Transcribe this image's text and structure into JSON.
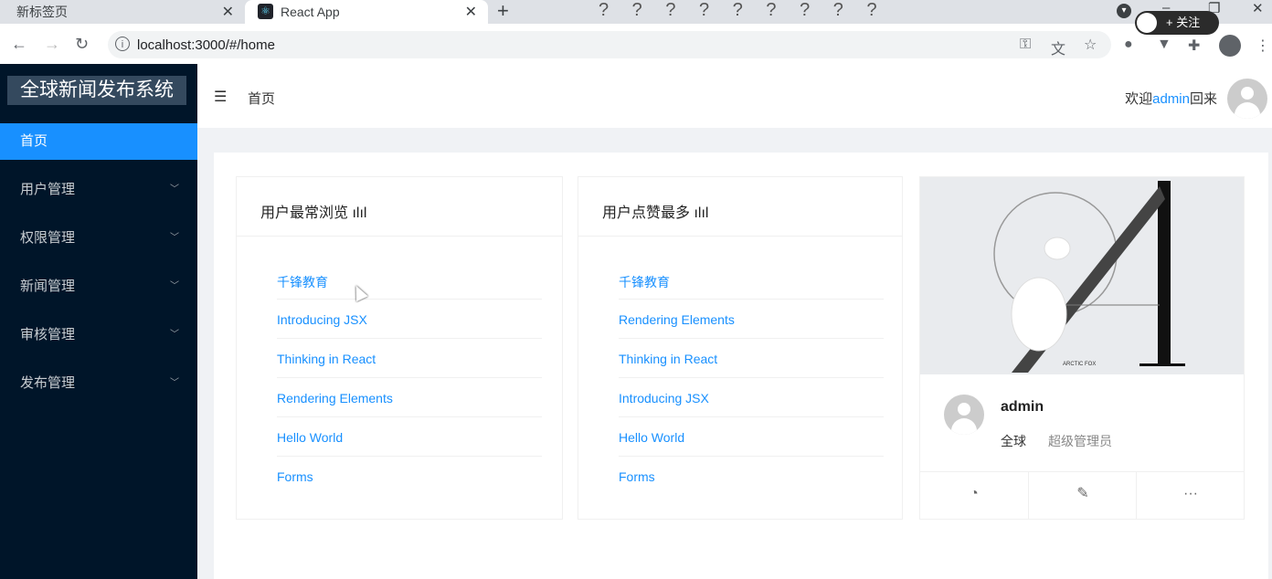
{
  "browser": {
    "tabs": [
      {
        "title": "新标签页",
        "active": false
      },
      {
        "title": "React App",
        "active": true
      }
    ],
    "new_tab": "+",
    "close_glyph": "✕",
    "question_marks": "? ? ? ? ? ? ? ? ?",
    "follow_button": "+ 关注",
    "url": "localhost:3000/#/home"
  },
  "sidebar": {
    "logo": "全球新闻发布系统",
    "items": [
      {
        "label": "首页",
        "selected": true
      },
      {
        "label": "用户管理"
      },
      {
        "label": "权限管理"
      },
      {
        "label": "新闻管理"
      },
      {
        "label": "审核管理"
      },
      {
        "label": "发布管理"
      }
    ]
  },
  "header": {
    "breadcrumb": "首页",
    "welcome_prefix": "欢迎",
    "welcome_user": "admin",
    "welcome_suffix": "回来"
  },
  "cards": {
    "most_viewed": {
      "title": "用户最常浏览",
      "items": [
        "千锋教育",
        "Introducing JSX",
        "Thinking in React",
        "Rendering Elements",
        "Hello World",
        "Forms"
      ]
    },
    "most_liked": {
      "title": "用户点赞最多",
      "items": [
        "千锋教育",
        "Rendering Elements",
        "Thinking in React",
        "Introducing JSX",
        "Hello World",
        "Forms"
      ]
    },
    "profile": {
      "cover_text": "ARCTIC FOX",
      "username": "admin",
      "region": "全球",
      "role": "超级管理员"
    }
  },
  "colors": {
    "sider": "#001529",
    "selected": "#1890ff",
    "link": "#1890ff"
  }
}
